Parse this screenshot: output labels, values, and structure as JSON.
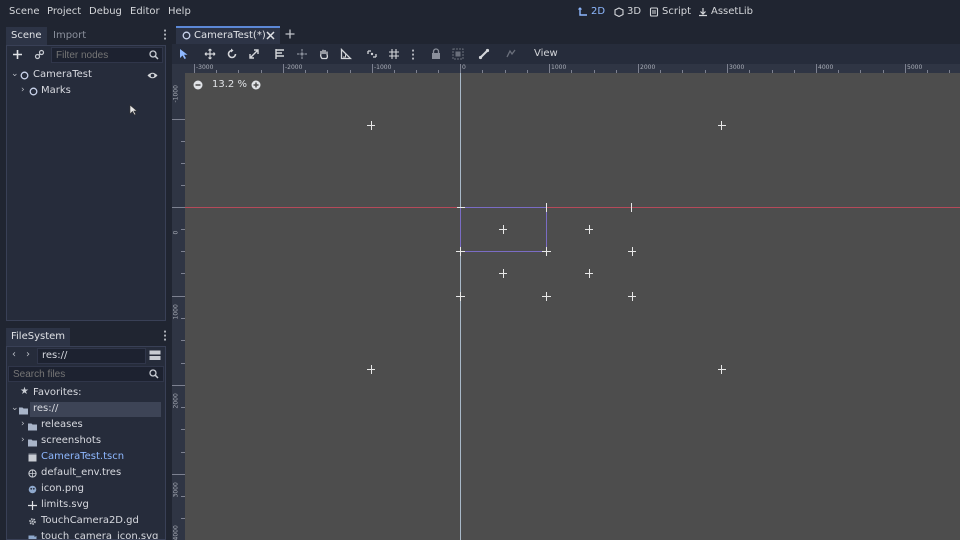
{
  "menubar": {
    "items": [
      "Scene",
      "Project",
      "Debug",
      "Editor",
      "Help"
    ],
    "modes": [
      {
        "label": "2D",
        "icon": "2d-mode-icon",
        "active": true
      },
      {
        "label": "3D",
        "icon": "3d-mode-icon",
        "active": false
      },
      {
        "label": "Script",
        "icon": "script-icon",
        "active": false
      },
      {
        "label": "AssetLib",
        "icon": "assetlib-icon",
        "active": false
      }
    ]
  },
  "scene_dock": {
    "tabs": [
      "Scene",
      "Import"
    ],
    "filter_placeholder": "Filter nodes",
    "nodes": [
      {
        "name": "CameraTest",
        "icon": "node2d-icon",
        "expanded": true,
        "visible_toggle": true
      },
      {
        "name": "Marks",
        "icon": "node2d-icon",
        "expanded": false
      }
    ]
  },
  "filesystem_dock": {
    "tab": "FileSystem",
    "path": "res://",
    "search_placeholder": "Search files",
    "favorites_label": "Favorites:",
    "root_label": "res://",
    "entries": [
      {
        "name": "releases",
        "type": "folder"
      },
      {
        "name": "screenshots",
        "type": "folder"
      },
      {
        "name": "CameraTest.tscn",
        "type": "scene"
      },
      {
        "name": "default_env.tres",
        "type": "resource"
      },
      {
        "name": "icon.png",
        "type": "image"
      },
      {
        "name": "limits.svg",
        "type": "svg"
      },
      {
        "name": "TouchCamera2D.gd",
        "type": "script"
      },
      {
        "name": "touch_camera_icon.svg",
        "type": "svg"
      }
    ]
  },
  "editor": {
    "scene_tab": "CameraTest(*)",
    "view_menu": "View",
    "zoom": "13.2 %",
    "ruler_top_labels": [
      "-3000",
      "-2000",
      "-1000",
      "0",
      "1000",
      "2000",
      "3000",
      "4000",
      "5000"
    ],
    "ruler_left_labels": [
      "-1000",
      "0",
      "1000",
      "2000",
      "3000",
      "4000"
    ]
  },
  "colors": {
    "accent": "#8eb8ff",
    "viewport_bg": "#4d4d4d",
    "x_axis": "#b54a5a",
    "y_axis": "#a8b8c8",
    "camera_rect": "#7a6cc4"
  }
}
